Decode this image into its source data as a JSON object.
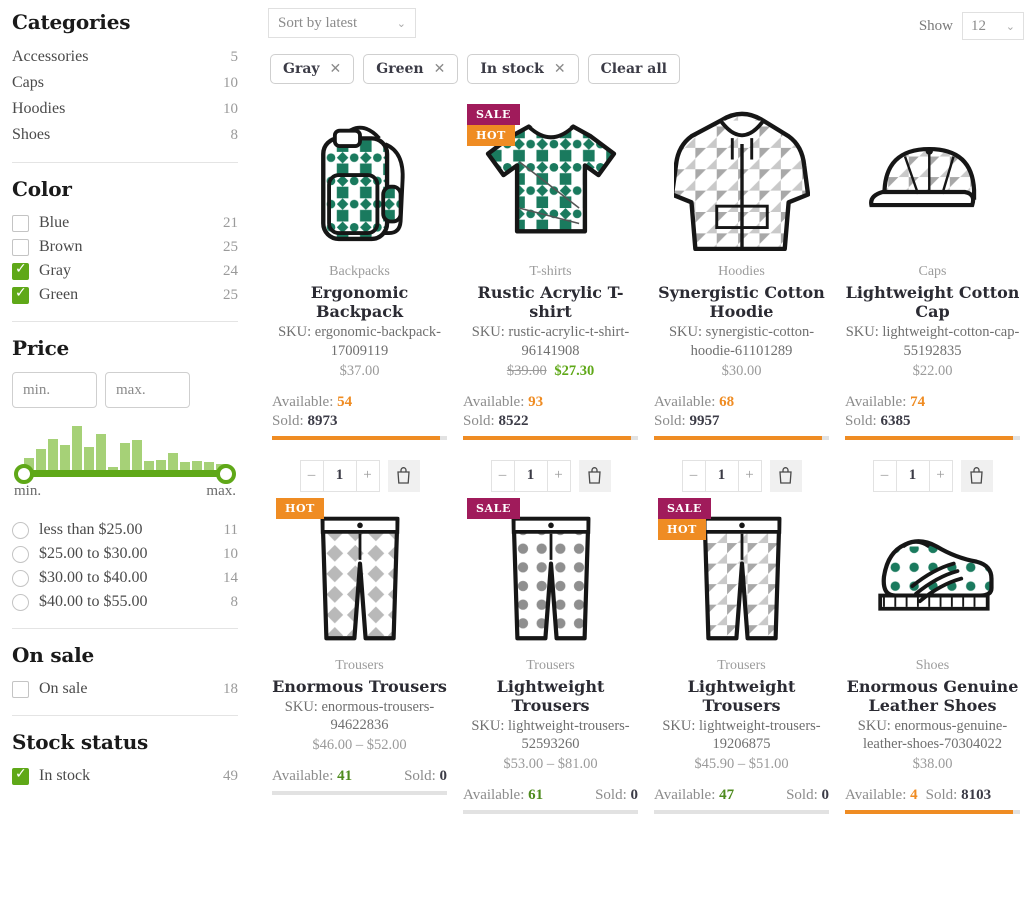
{
  "sidebar": {
    "categories": {
      "title": "Categories",
      "items": [
        {
          "label": "Accessories",
          "count": "5"
        },
        {
          "label": "Caps",
          "count": "10"
        },
        {
          "label": "Hoodies",
          "count": "10"
        },
        {
          "label": "Shoes",
          "count": "8"
        }
      ]
    },
    "color": {
      "title": "Color",
      "items": [
        {
          "label": "Blue",
          "count": "21",
          "checked": false
        },
        {
          "label": "Brown",
          "count": "25",
          "checked": false
        },
        {
          "label": "Gray",
          "count": "24",
          "checked": true
        },
        {
          "label": "Green",
          "count": "25",
          "checked": true
        }
      ]
    },
    "price": {
      "title": "Price",
      "min_placeholder": "min.",
      "max_placeholder": "max.",
      "min_value": "",
      "max_value": "",
      "slider_min_label": "min.",
      "slider_max_label": "max.",
      "histogram": [
        18,
        32,
        48,
        38,
        68,
        36,
        56,
        4,
        42,
        46,
        14,
        16,
        26,
        12,
        14,
        12,
        10
      ],
      "ranges": [
        {
          "label": "less than $25.00",
          "count": "11"
        },
        {
          "label": "$25.00 to $30.00",
          "count": "10"
        },
        {
          "label": "$30.00 to $40.00",
          "count": "14"
        },
        {
          "label": "$40.00 to $55.00",
          "count": "8"
        }
      ]
    },
    "on_sale": {
      "title": "On sale",
      "items": [
        {
          "label": "On sale",
          "count": "18",
          "checked": false
        }
      ]
    },
    "stock_status": {
      "title": "Stock status",
      "items": [
        {
          "label": "In stock",
          "count": "49",
          "checked": true
        }
      ]
    }
  },
  "toolbar": {
    "sort_value": "Sort by latest",
    "show_label": "Show",
    "show_value": "12",
    "chips": [
      {
        "label": "Gray",
        "removable": true
      },
      {
        "label": "Green",
        "removable": true
      },
      {
        "label": "In stock",
        "removable": true
      },
      {
        "label": "Clear all",
        "removable": false
      }
    ]
  },
  "labels": {
    "available": "Available:",
    "sold": "Sold:",
    "sku_prefix": "SKU:",
    "qty": "1",
    "minus": "–",
    "plus": "+"
  },
  "products": [
    {
      "category": "Backpacks",
      "name": "Ergonomic Backpack",
      "sku": "SKU: ergonomic-backpack-17009119",
      "price": "$37.00",
      "price_old": "",
      "price_new": "",
      "available": "54",
      "sold": "8973",
      "available_color": "orange",
      "progress_pct": 96,
      "progress_active": true,
      "stats_layout": "stacked",
      "badges": [],
      "icon": "backpack-icon",
      "has_stepper": true
    },
    {
      "category": "T-shirts",
      "name": "Rustic Acrylic T-shirt",
      "sku": "SKU: rustic-acrylic-t-shirt-96141908",
      "price": "",
      "price_old": "$39.00",
      "price_new": "$27.30",
      "available": "93",
      "sold": "8522",
      "available_color": "orange",
      "progress_pct": 96,
      "progress_active": true,
      "stats_layout": "stacked",
      "badges": [
        "SALE",
        "HOT"
      ],
      "icon": "tshirt-icon",
      "has_stepper": true
    },
    {
      "category": "Hoodies",
      "name": "Synergistic Cotton Hoodie",
      "sku": "SKU: synergistic-cotton-hoodie-61101289",
      "price": "$30.00",
      "price_old": "",
      "price_new": "",
      "available": "68",
      "sold": "9957",
      "available_color": "orange",
      "progress_pct": 96,
      "progress_active": true,
      "stats_layout": "stacked",
      "badges": [],
      "icon": "hoodie-icon",
      "has_stepper": true
    },
    {
      "category": "Caps",
      "name": "Lightweight Cotton Cap",
      "sku": "SKU: lightweight-cotton-cap-55192835",
      "price": "$22.00",
      "price_old": "",
      "price_new": "",
      "available": "74",
      "sold": "6385",
      "available_color": "orange",
      "progress_pct": 96,
      "progress_active": true,
      "stats_layout": "stacked",
      "badges": [],
      "icon": "cap-icon",
      "has_stepper": true
    },
    {
      "category": "Trousers",
      "name": "Enormous Trousers",
      "sku": "SKU: enormous-trousers-94622836",
      "price": "$46.00 – $52.00",
      "price_old": "",
      "price_new": "",
      "available": "41",
      "sold": "0",
      "available_color": "green",
      "progress_pct": 100,
      "progress_active": false,
      "stats_layout": "inline",
      "badges": [
        "HOT"
      ],
      "icon": "trousers-diamond-icon",
      "has_stepper": false
    },
    {
      "category": "Trousers",
      "name": "Lightweight Trousers",
      "sku": "SKU: lightweight-trousers-52593260",
      "price": "$53.00 – $81.00",
      "price_old": "",
      "price_new": "",
      "available": "61",
      "sold": "0",
      "available_color": "green",
      "progress_pct": 100,
      "progress_active": false,
      "stats_layout": "inline",
      "badges": [
        "SALE"
      ],
      "icon": "trousers-dot-icon",
      "has_stepper": false
    },
    {
      "category": "Trousers",
      "name": "Lightweight Trousers",
      "sku": "SKU: lightweight-trousers-19206875",
      "price": "$45.90 – $51.00",
      "price_old": "",
      "price_new": "",
      "available": "47",
      "sold": "0",
      "available_color": "green",
      "progress_pct": 100,
      "progress_active": false,
      "stats_layout": "inline",
      "badges": [
        "SALE",
        "HOT"
      ],
      "icon": "trousers-tri-icon",
      "has_stepper": false
    },
    {
      "category": "Shoes",
      "name": "Enormous Genuine Leather Shoes",
      "sku": "SKU: enormous-genuine-leather-shoes-70304022",
      "price": "$38.00",
      "price_old": "",
      "price_new": "",
      "available": "4",
      "sold": "8103",
      "available_color": "orange",
      "progress_pct": 96,
      "progress_active": true,
      "stats_layout": "tight",
      "badges": [],
      "icon": "shoes-icon",
      "has_stepper": false
    }
  ],
  "colors": {
    "accent_green": "#5fa818",
    "accent_orange": "#ef8c23",
    "badge_sale": "#a01b5b",
    "badge_hot": "#ef8c23",
    "art_teal": "#1a7a5e"
  }
}
